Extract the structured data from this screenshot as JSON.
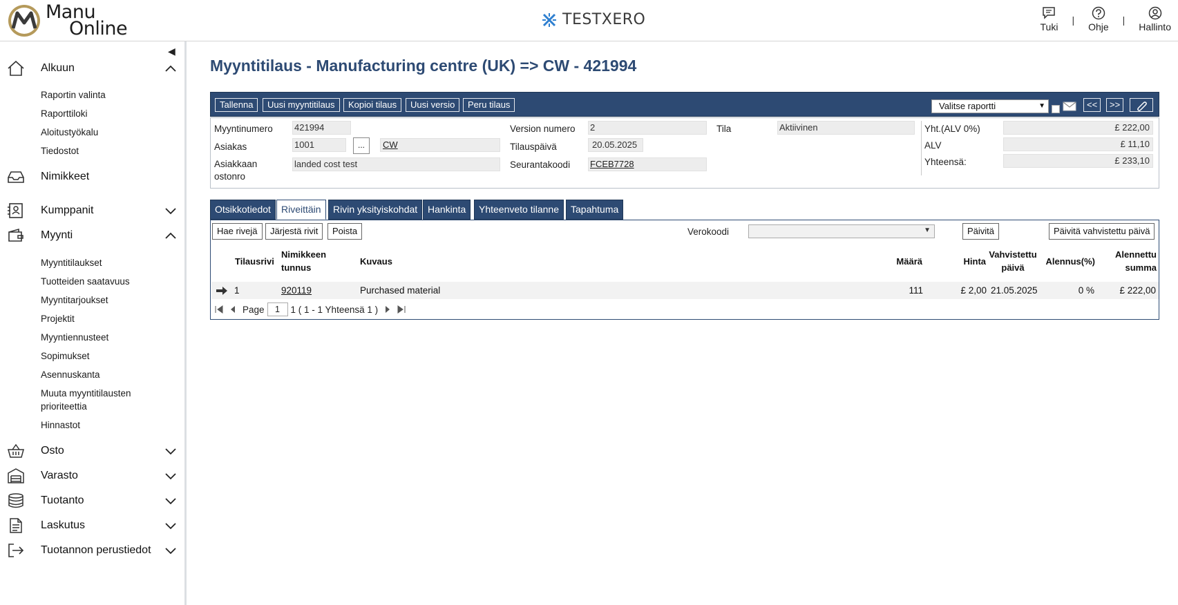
{
  "topbar": {
    "logo_line1": "Manu",
    "logo_line2": "Online",
    "company": "TESTXERO",
    "links": [
      "Tuki",
      "Ohje",
      "Hallinto"
    ],
    "separator": "|"
  },
  "sidebar": {
    "sections": [
      {
        "label": "Alkuun",
        "icon": "home-icon",
        "expanded": true,
        "items": [
          "Raportin valinta",
          "Raporttiloki",
          "Aloitustyökalu",
          "Tiedostot"
        ]
      },
      {
        "label": "Nimikkeet",
        "icon": "inbox-icon",
        "expanded": false
      },
      {
        "label": "Kumppanit",
        "icon": "contacts-icon",
        "expanded": false
      },
      {
        "label": "Myynti",
        "icon": "wallet-icon",
        "expanded": true,
        "items": [
          "Myyntitilaukset",
          "Tuotteiden saatavuus",
          "Myyntitarjoukset",
          "Projektit",
          "Myyntiennusteet",
          "Sopimukset",
          "Asennuskanta",
          "Muuta myyntitilausten",
          "prioriteettia",
          "Hinnastot"
        ]
      },
      {
        "label": "Osto",
        "icon": "basket-icon",
        "expanded": false
      },
      {
        "label": "Varasto",
        "icon": "warehouse-icon",
        "expanded": false
      },
      {
        "label": "Tuotanto",
        "icon": "database-icon",
        "expanded": false
      },
      {
        "label": "Laskutus",
        "icon": "document-icon",
        "expanded": false
      },
      {
        "label": "Tuotannon perustiedot",
        "icon": "exit-icon",
        "expanded": false
      }
    ]
  },
  "page": {
    "title": "Myyntitilaus - Manufacturing centre (UK) => CW - 421994"
  },
  "toolbar": {
    "buttons": [
      "Tallenna",
      "Uusi myyntitilaus",
      "Kopioi tilaus",
      "Uusi versio",
      "Peru tilaus"
    ],
    "report_select": "Valitse raportti",
    "nav_prev": "<<",
    "nav_next": ">>"
  },
  "header": {
    "myyntinumero_label": "Myyntinumero",
    "myyntinumero": "421994",
    "asiakas_label": "Asiakas",
    "asiakas_code": "1001",
    "asiakas_btn": "...",
    "asiakas_name": "CW",
    "ostonro_label_1": "Asiakkaan",
    "ostonro_label_2": "ostonro",
    "ostonro": "landed cost test",
    "version_label": "Version numero",
    "version": "2",
    "tilauspaiva_label": "Tilauspäivä",
    "tilauspaiva": "20.05.2025",
    "seuranta_label": "Seurantakoodi",
    "seuranta": "FCEB7728",
    "tila_label": "Tila",
    "tila": "Aktiivinen",
    "yht_label": "Yht.(ALV 0%)",
    "yht": "£ 222,00",
    "alv_label": "ALV",
    "alv": "£ 11,10",
    "yhteensa_label": "Yhteensä:",
    "yhteensa": "£ 233,10"
  },
  "tabs": [
    "Otsikkotiedot",
    "Riveittäin",
    "Rivin yksityiskohdat",
    "Hankinta",
    "Yhteenveto tilanne",
    "Tapahtuma"
  ],
  "active_tab": "Riveittäin",
  "rows": {
    "buttons": [
      "Hae rivejä",
      "Järjestä rivit",
      "Poista"
    ],
    "verokoodi_label": "Verokoodi",
    "verokoodi_value": "",
    "update_btn": "Päivitä",
    "update_confirmed_btn": "Päivitä vahvistettu päivä",
    "columns": {
      "tilausrivi": "Tilausrivi",
      "nimike_1": "Nimikkeen",
      "nimike_2": "tunnus",
      "kuvaus": "Kuvaus",
      "maara": "Määrä",
      "hinta": "Hinta",
      "vahv_1": "Vahvistettu",
      "vahv_2": "päivä",
      "alennus": "Alennus(%)",
      "alsumma_1": "Alennettu",
      "alsumma_2": "summa"
    },
    "data": [
      {
        "tilausrivi": "1",
        "nimike": "920119",
        "kuvaus": "Purchased material",
        "maara": "111",
        "hinta": "£ 2,00",
        "vahvistettu": "21.05.2025",
        "alennus": "0 %",
        "summa": "£ 222,00"
      }
    ],
    "pager": {
      "page_label": "Page",
      "page": "1",
      "info": "1 ( 1 - 1 Yhteensä 1 )"
    }
  },
  "colors": {
    "primary": "#2d4a73",
    "field_bg": "#ededed",
    "logo_gold": "#b59a5b"
  }
}
